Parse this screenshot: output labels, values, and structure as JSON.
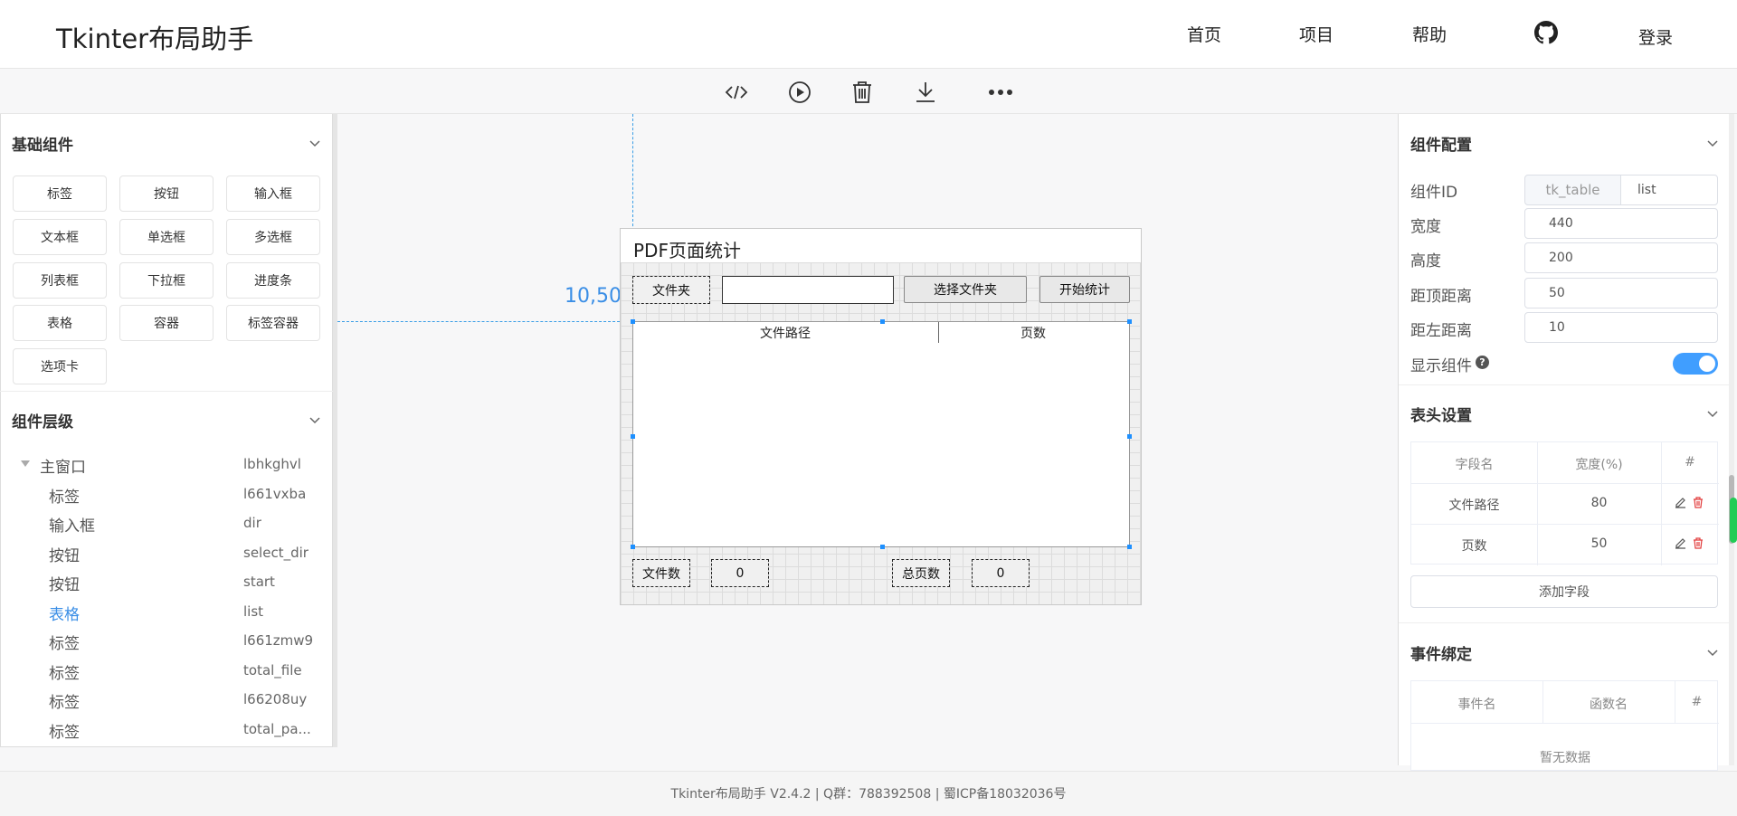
{
  "header": {
    "logo": "Tkinter布局助手",
    "nav": [
      "首页",
      "项目",
      "帮助"
    ],
    "login": "登录"
  },
  "toolbar": {
    "icons": [
      "code-icon",
      "play-icon",
      "trash-icon",
      "download-icon",
      "more-icon"
    ]
  },
  "left": {
    "basic_title": "基础组件",
    "components": [
      "标签",
      "按钮",
      "输入框",
      "文本框",
      "单选框",
      "多选框",
      "列表框",
      "下拉框",
      "进度条",
      "表格",
      "容器",
      "标签容器",
      "选项卡"
    ],
    "hierarchy_title": "组件层级",
    "tree": [
      {
        "name": "主窗口",
        "id": "lbhkghvl"
      },
      {
        "name": "标签",
        "id": "l661vxba"
      },
      {
        "name": "输入框",
        "id": "dir"
      },
      {
        "name": "按钮",
        "id": "select_dir"
      },
      {
        "name": "按钮",
        "id": "start"
      },
      {
        "name": "表格",
        "id": "list"
      },
      {
        "name": "标签",
        "id": "l661zmw9"
      },
      {
        "name": "标签",
        "id": "total_file"
      },
      {
        "name": "标签",
        "id": "l66208uy"
      },
      {
        "name": "标签",
        "id": "total_pa..."
      }
    ]
  },
  "canvas": {
    "coord": "10,50",
    "window_title": "PDF页面统计",
    "folder_label": "文件夹",
    "select_button": "选择文件夹",
    "start_button": "开始统计",
    "table_headers": [
      "文件路径",
      "页数"
    ],
    "file_count_label": "文件数",
    "file_count_value": "0",
    "total_pages_label": "总页数",
    "total_pages_value": "0"
  },
  "right": {
    "config_title": "组件配置",
    "id_label": "组件ID",
    "id_prefix": "tk_table",
    "id_value": "list",
    "width_label": "宽度",
    "width_value": "440",
    "height_label": "高度",
    "height_value": "200",
    "top_label": "距顶距离",
    "top_value": "50",
    "left_label": "距左距离",
    "left_value": "10",
    "show_label": "显示组件",
    "header_title": "表头设置",
    "header_cols": [
      "字段名",
      "宽度(%)",
      "#"
    ],
    "header_rows": [
      {
        "name": "文件路径",
        "width": "80"
      },
      {
        "name": "页数",
        "width": "50"
      }
    ],
    "add_field": "添加字段",
    "event_title": "事件绑定",
    "event_cols": [
      "事件名",
      "函数名",
      "#"
    ],
    "event_empty": "暂无数据"
  },
  "footer": "Tkinter布局助手 V2.4.2 | Q群：788392508 | 蜀ICP备18032036号",
  "colors": {
    "accent": "#409eff",
    "selected_tree": "#3a8ee6",
    "guide": "#3a9ee6",
    "delete": "#e23c3c"
  }
}
